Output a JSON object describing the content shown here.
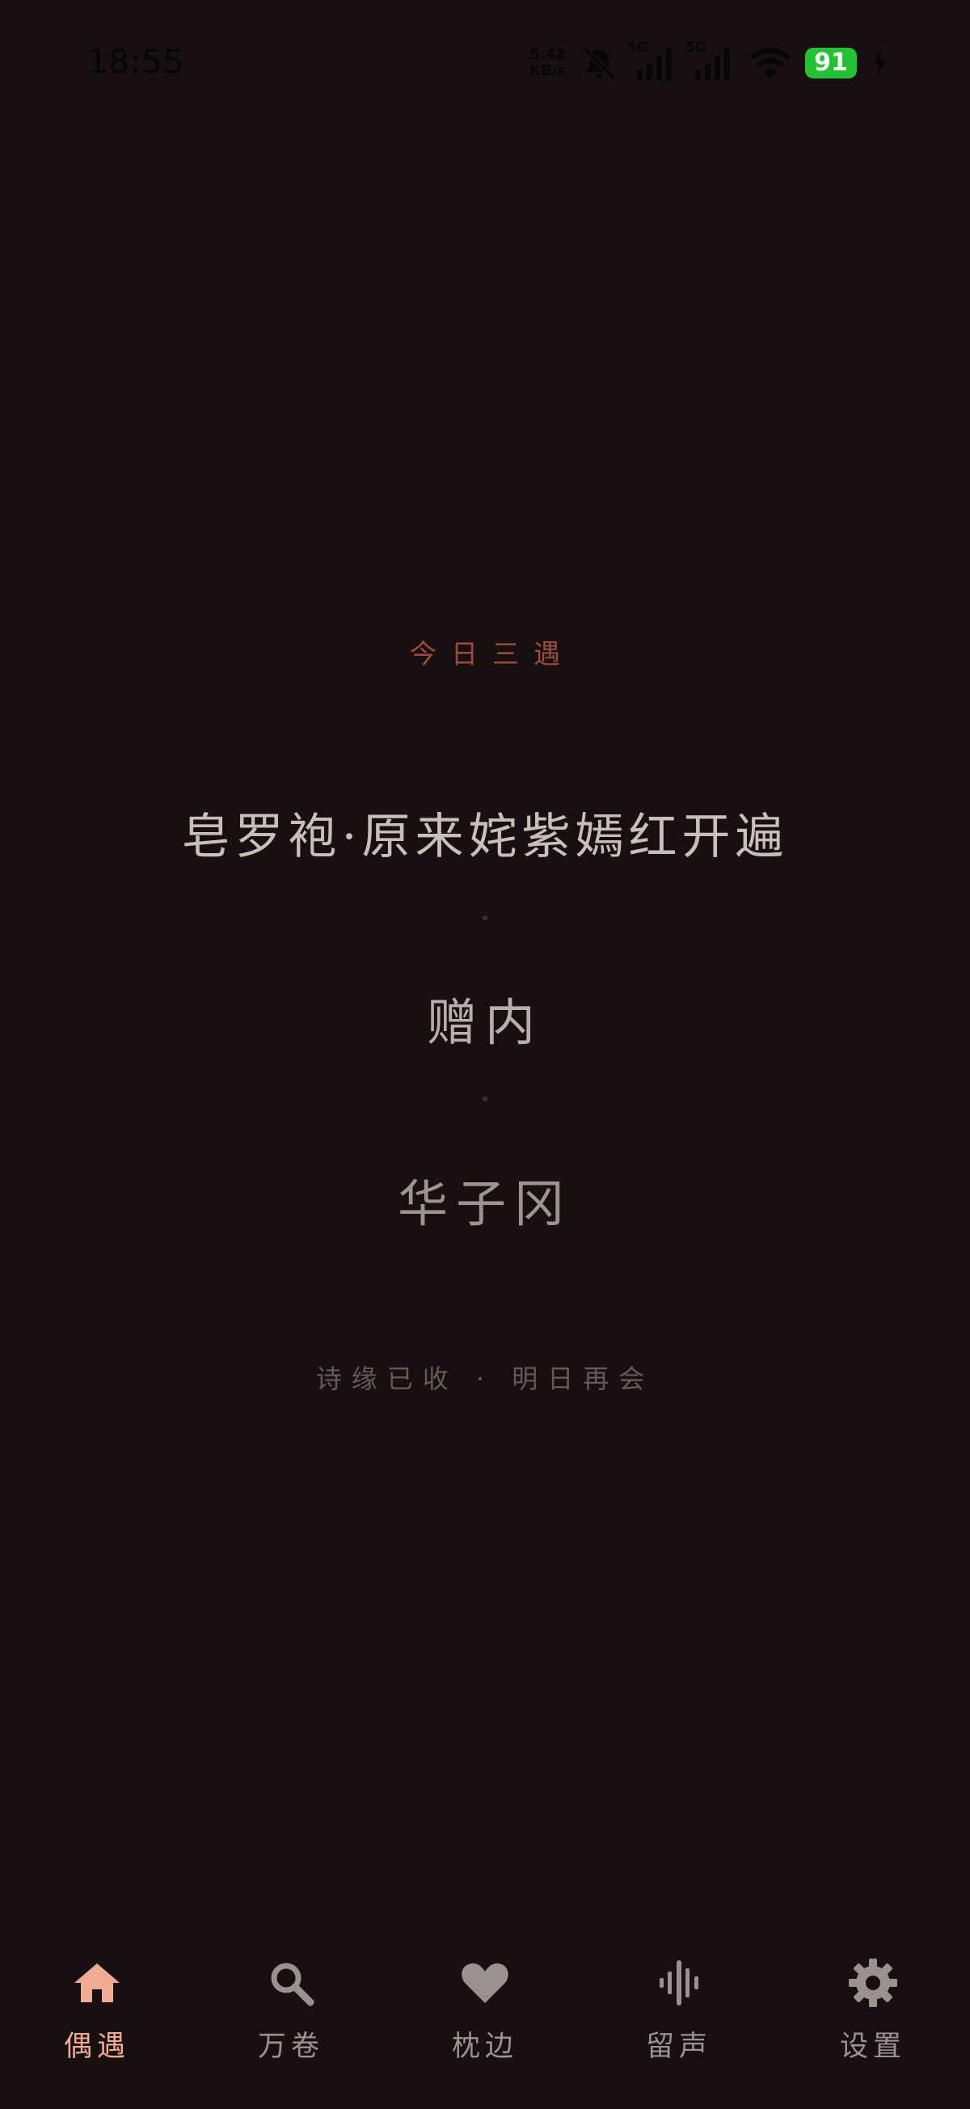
{
  "status_bar": {
    "time": "18:55",
    "net_speed_value": "5.42",
    "net_speed_unit": "KB/s",
    "sim1_tag": "5G",
    "sim2_tag": "5G",
    "battery": "91",
    "icons": [
      "mute-icon",
      "signal-icon",
      "signal-icon",
      "wifi-icon",
      "battery-icon",
      "charging-icon"
    ]
  },
  "main": {
    "headline": "今日三遇",
    "poems": [
      "皂罗袍·原来姹紫嫣红开遍",
      "赠内",
      "华子冈"
    ],
    "footer_note": "诗缘已收 · 明日再会"
  },
  "nav": {
    "items": [
      {
        "label": "偶遇",
        "icon": "home-icon",
        "active": true
      },
      {
        "label": "万卷",
        "icon": "search-icon",
        "active": false
      },
      {
        "label": "枕边",
        "icon": "heart-icon",
        "active": false
      },
      {
        "label": "留声",
        "icon": "audio-wave-icon",
        "active": false
      },
      {
        "label": "设置",
        "icon": "gear-icon",
        "active": false
      }
    ]
  },
  "colors": {
    "background": "#181010",
    "accent": "#f2ab93",
    "headline": "#9b4b40",
    "inactive": "#9a9291",
    "battery": "#22c233"
  }
}
